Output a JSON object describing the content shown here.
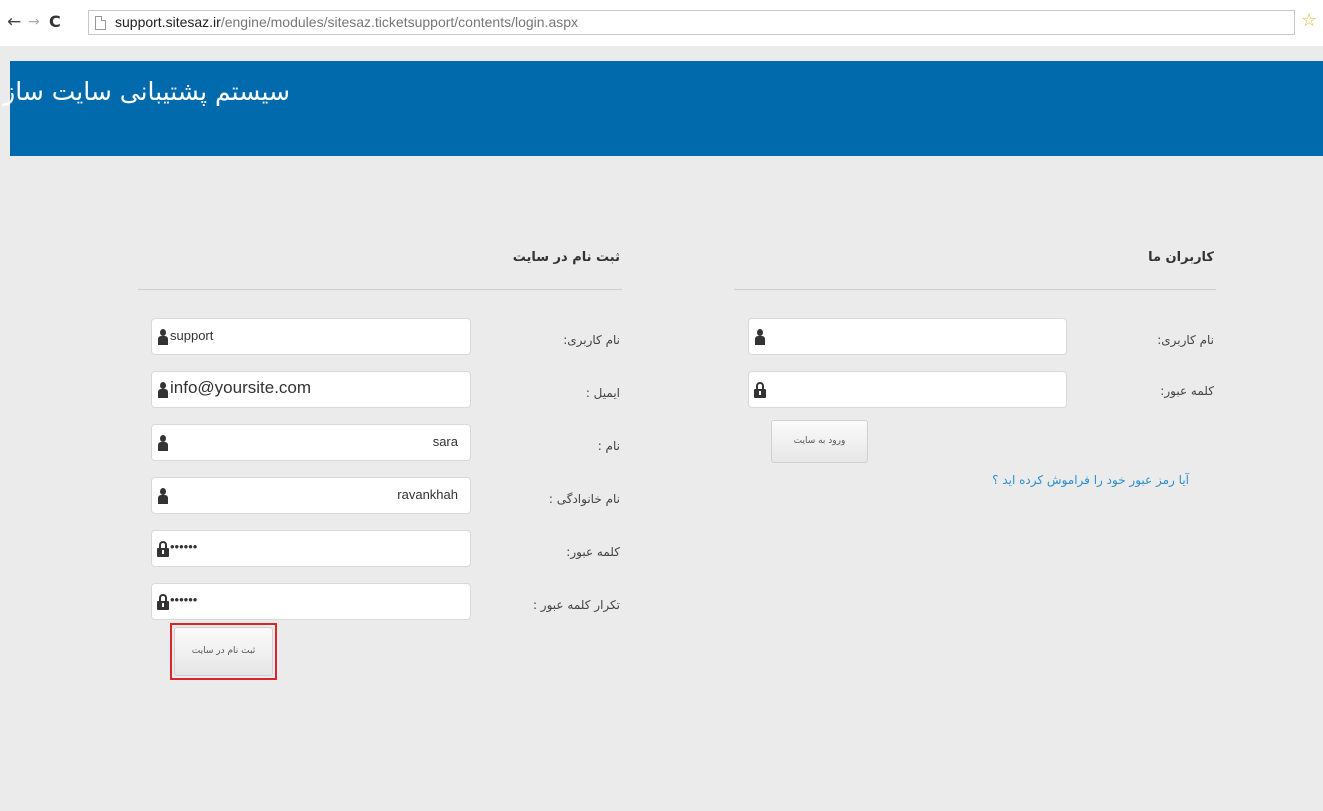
{
  "browser": {
    "url_host": "support.sitesaz.ir",
    "url_path": "/engine/modules/sitesaz.ticketsupport/contents/login.aspx",
    "icons": [
      "back-arrow-icon",
      "forward-arrow-icon",
      "reload-icon",
      "page-icon",
      "bookmark-star-icon"
    ]
  },
  "header": {
    "title": "سیستم پشتیبانی سایت ساز",
    "background": "#006aad"
  },
  "login": {
    "title": "کاربران ما",
    "username_label": "نام کاربری:",
    "username_value": "",
    "password_label": "کلمه عبور:",
    "password_value": "",
    "submit_label": "ورود به سایت",
    "forgot_link": "آیا رمز عبور خود را فراموش کرده اید ؟"
  },
  "register": {
    "title": "ثبت نام در سایت",
    "username_label": "نام کاربری:",
    "username_value": "support",
    "email_label": "ایمیل :",
    "email_value": "info@yoursite.com",
    "firstname_label": "نام :",
    "firstname_value": "sara",
    "lastname_label": "نام خانوادگی :",
    "lastname_value": "ravankhah",
    "password_label": "کلمه عبور:",
    "password_value": "••••••",
    "password_repeat_label": "تکرار کلمه عبور :",
    "password_repeat_value": "••••••",
    "submit_label": "ثبت نام در سایت"
  },
  "colors": {
    "link": "#2a8fcf",
    "highlight_border": "#d9262c"
  }
}
